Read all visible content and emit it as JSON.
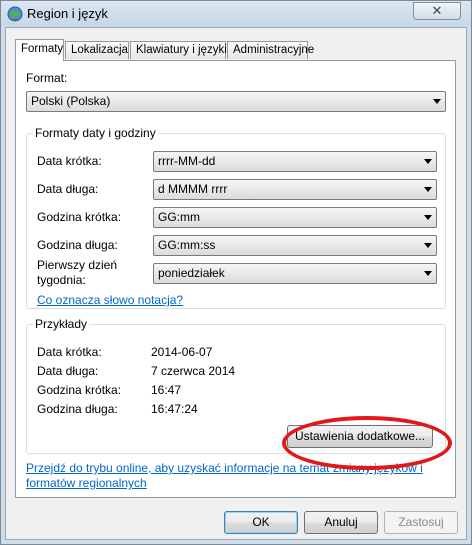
{
  "window": {
    "title": "Region i język",
    "close_symbol": "✕"
  },
  "tabs": [
    {
      "label": "Formaty",
      "active": true
    },
    {
      "label": "Lokalizacja",
      "active": false
    },
    {
      "label": "Klawiatury i języki",
      "active": false
    },
    {
      "label": "Administracyjne",
      "active": false
    }
  ],
  "format": {
    "label": "Format:",
    "value": "Polski (Polska)"
  },
  "date_time_formats": {
    "title": "Formaty daty i godziny",
    "rows": [
      {
        "label": "Data krótka:",
        "value": "rrrr-MM-dd"
      },
      {
        "label": "Data długa:",
        "value": "d MMMM rrrr"
      },
      {
        "label": "Godzina krótka:",
        "value": "GG:mm"
      },
      {
        "label": "Godzina długa:",
        "value": "GG:mm:ss"
      },
      {
        "label_line1": "Pierwszy dzień",
        "label_line2": "tygodnia:",
        "value": "poniedziałek"
      }
    ],
    "notation_link": "Co oznacza słowo notacja?"
  },
  "examples": {
    "title": "Przykłady",
    "rows": [
      {
        "label": "Data krótka:",
        "value": "2014-06-07"
      },
      {
        "label": "Data długa:",
        "value": "7 czerwca 2014"
      },
      {
        "label": "Godzina krótka:",
        "value": "16:47"
      },
      {
        "label": "Godzina długa:",
        "value": "16:47:24"
      }
    ]
  },
  "additional_settings_button": "Ustawienia dodatkowe...",
  "online_link_line1": "Przejdź do trybu online, aby uzyskać informacje na temat zmiany języków i",
  "online_link_line2": "formatów regionalnych",
  "footer": {
    "ok": "OK",
    "cancel": "Anuluj",
    "apply": "Zastosuj"
  },
  "colors": {
    "highlight": "#e01a1a",
    "link": "#0066cc"
  }
}
